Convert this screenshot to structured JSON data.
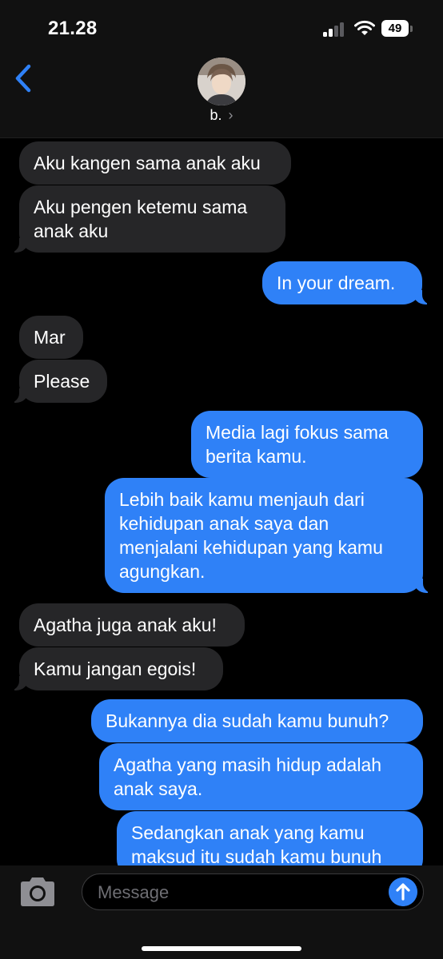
{
  "status_bar": {
    "time": "21.28",
    "battery": "49"
  },
  "header": {
    "contact_name": "b.",
    "chevron": "›",
    "back_icon": "chevron-left-icon"
  },
  "messages": [
    {
      "side": "in",
      "text": "Aku kangen sama anak aku"
    },
    {
      "side": "in",
      "text": "Aku pengen ketemu sama anak aku"
    },
    {
      "side": "out",
      "text": "In your dream."
    },
    {
      "side": "in",
      "text": "Mar"
    },
    {
      "side": "in",
      "text": "Please"
    },
    {
      "side": "out",
      "text": "Media lagi fokus sama berita kamu."
    },
    {
      "side": "out",
      "text": "Lebih baik kamu menjauh dari kehidupan anak saya dan menjalani kehidupan yang kamu agungkan."
    },
    {
      "side": "in",
      "text": "Agatha juga anak aku!"
    },
    {
      "side": "in",
      "text": "Kamu jangan egois!"
    },
    {
      "side": "out",
      "text": "Bukannya dia sudah kamu bunuh?"
    },
    {
      "side": "out",
      "text": "Agatha yang masih hidup adalah anak saya."
    },
    {
      "side": "out",
      "text": "Sedangkan anak yang kamu maksud itu sudah kamu bunuh"
    }
  ],
  "composer": {
    "placeholder": "Message"
  },
  "colors": {
    "incoming": "#262628",
    "outgoing": "#2f81f7",
    "accent": "#2f81f7",
    "background": "#000000"
  }
}
